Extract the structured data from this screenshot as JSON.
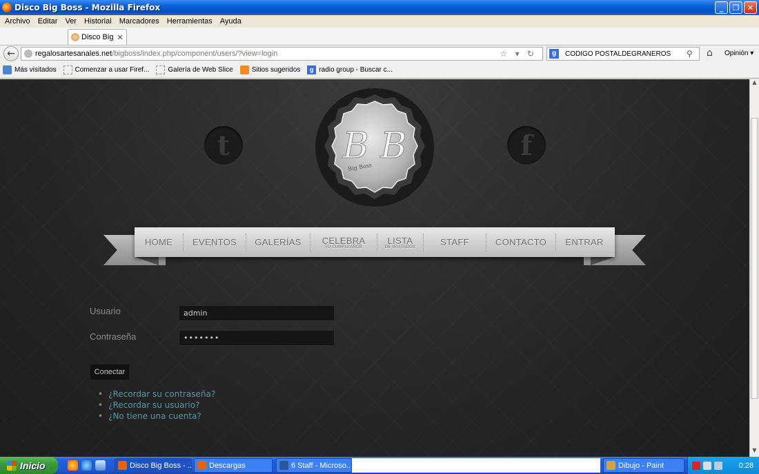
{
  "window": {
    "title": "Disco Big Boss - Mozilla Firefox",
    "minimize": "_",
    "maximize": "❐",
    "close": "✕"
  },
  "menu": [
    "Archivo",
    "Editar",
    "Ver",
    "Historial",
    "Marcadores",
    "Herramientas",
    "Ayuda"
  ],
  "tab": {
    "label": "Disco Big ...",
    "close": "✕"
  },
  "tab_controls": {
    "scroll": "›",
    "new_tab": "+",
    "list": "▾"
  },
  "address": {
    "domain": "regalosartesanales.net",
    "path": "/bigboss/index.php/component/users/?view=login",
    "icons": "☆ ▾ ↻"
  },
  "search": {
    "engine": "g",
    "value": "CODIGO POSTALDEGRANEROS",
    "icon": "⚲"
  },
  "toolbar": {
    "back": "←",
    "home": "⌂",
    "opinion": "Opinión ▾"
  },
  "bookmarks": [
    {
      "label": "Más visitados",
      "icon": "blue"
    },
    {
      "label": "Comenzar a usar Firef...",
      "icon": "dash"
    },
    {
      "label": "Galería de Web Slice",
      "icon": "dash"
    },
    {
      "label": "Sitios sugeridos",
      "icon": "orange"
    },
    {
      "label": "radio group - Buscar c...",
      "icon": "g"
    }
  ],
  "site": {
    "social": {
      "twitter": "t",
      "facebook": "f"
    },
    "logo": {
      "monogram": "B B",
      "caption": "Big Boss"
    },
    "nav": [
      {
        "label": "HOME",
        "sub": ""
      },
      {
        "label": "EVENTOS",
        "sub": ""
      },
      {
        "label": "GALERÍAS",
        "sub": ""
      },
      {
        "label": "CELEBRA",
        "sub": "TU CUMPLEAÑOS"
      },
      {
        "label": "LISTA",
        "sub": "DE INVITADOS"
      },
      {
        "label": "STAFF",
        "sub": ""
      },
      {
        "label": "CONTACTO",
        "sub": ""
      },
      {
        "label": "ENTRAR",
        "sub": ""
      }
    ],
    "login": {
      "username_label": "Usuario",
      "username_value": "admin",
      "password_label": "Contraseña",
      "password_value": "•••••••",
      "submit_label": "Conectar",
      "links": [
        "¿Recordar su contraseña?",
        "¿Recordar su usuario?",
        "¿No tiene una cuenta?"
      ]
    }
  },
  "scrollbar": {
    "up": "▲",
    "down": "▼"
  },
  "taskbar": {
    "start_label": "Inicio",
    "buttons": [
      {
        "label": "Disco Big Boss - ...",
        "color": "#e8620a"
      },
      {
        "label": "Descargas",
        "color": "#e8620a"
      },
      {
        "label": "6 Staff - Microso...",
        "color": "#2b579a"
      },
      {
        "label": "Dibujo - Paint",
        "color": "#d8a13c"
      }
    ],
    "clock": "0:28"
  }
}
